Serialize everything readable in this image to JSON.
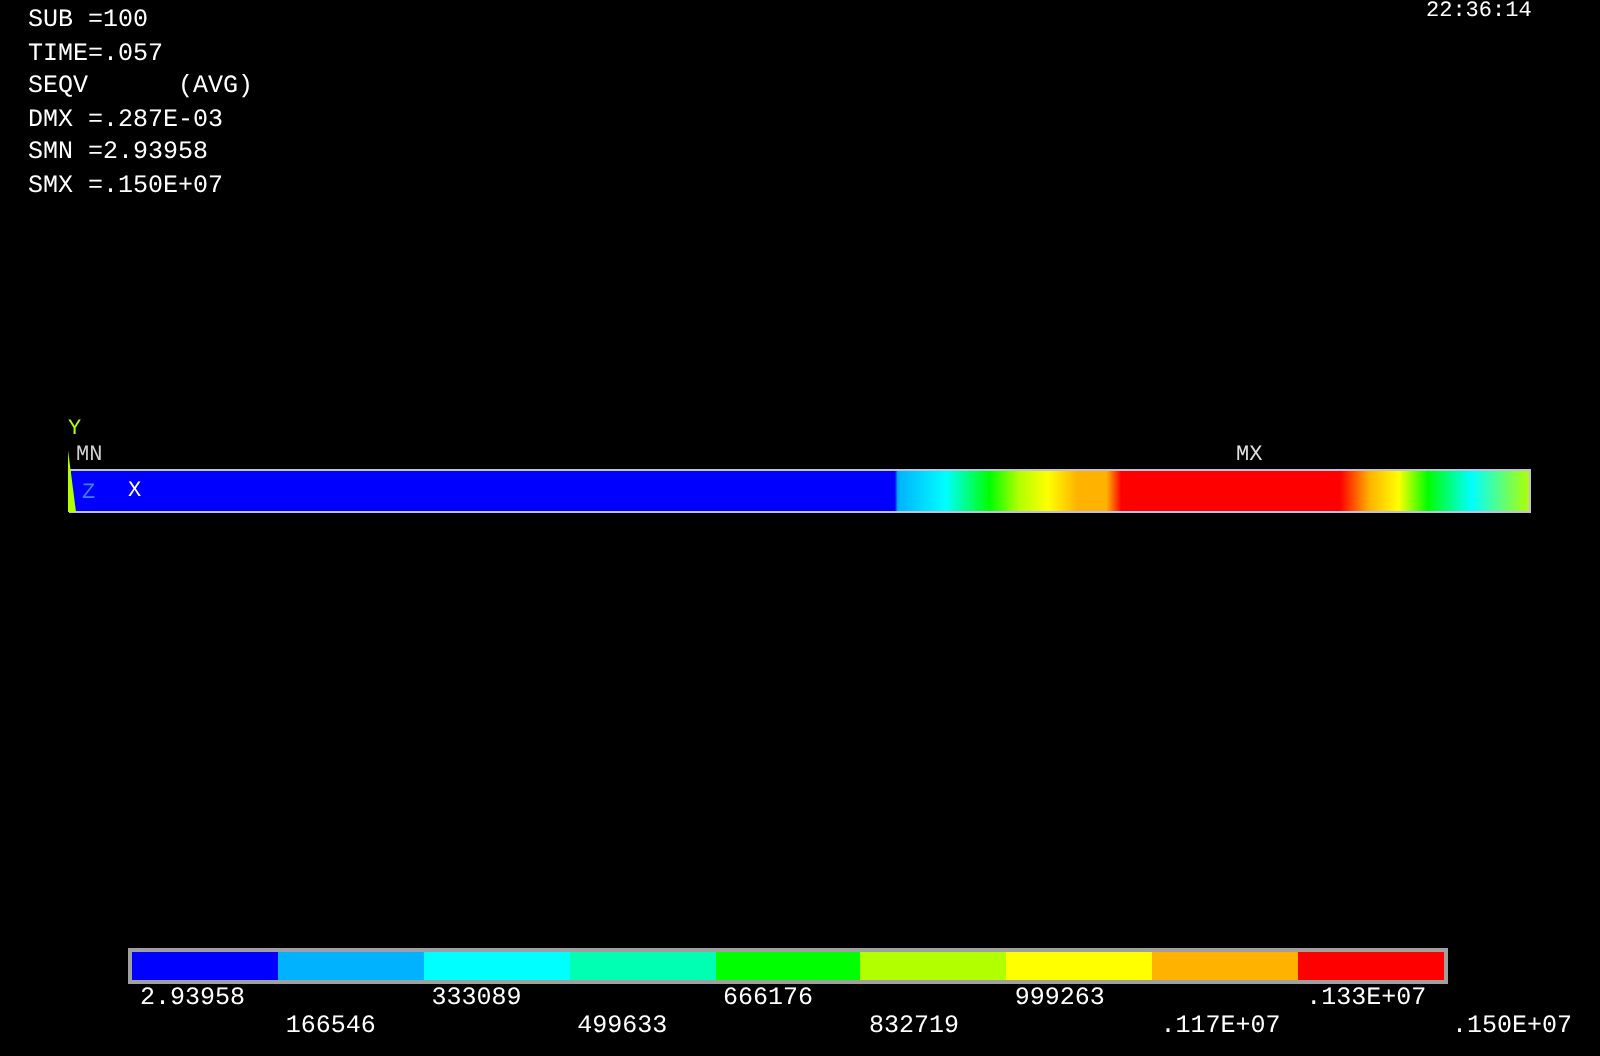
{
  "clock": "22:36:14",
  "info_lines": [
    "SUB =100",
    "TIME=.057",
    "SEQV      (AVG)",
    "DMX =.287E-03",
    "SMN =2.93958",
    "SMX =.150E+07"
  ],
  "plot": {
    "min_label": "MN",
    "max_label": "MX",
    "axis_x": "X",
    "axis_y": "Y",
    "axis_z": "Z"
  },
  "legend": {
    "bands": [
      {
        "color": "#0000ff"
      },
      {
        "color": "#00b2ff"
      },
      {
        "color": "#00ffff"
      },
      {
        "color": "#00ffb2"
      },
      {
        "color": "#00ff00"
      },
      {
        "color": "#b2ff00"
      },
      {
        "color": "#ffff00"
      },
      {
        "color": "#ffb200"
      },
      {
        "color": "#ff0000"
      }
    ],
    "ticks": [
      "2.93958",
      "166546",
      "333089",
      "499633",
      "666176",
      "832719",
      "999263",
      ".117E+07",
      ".133E+07",
      ".150E+07"
    ]
  }
}
